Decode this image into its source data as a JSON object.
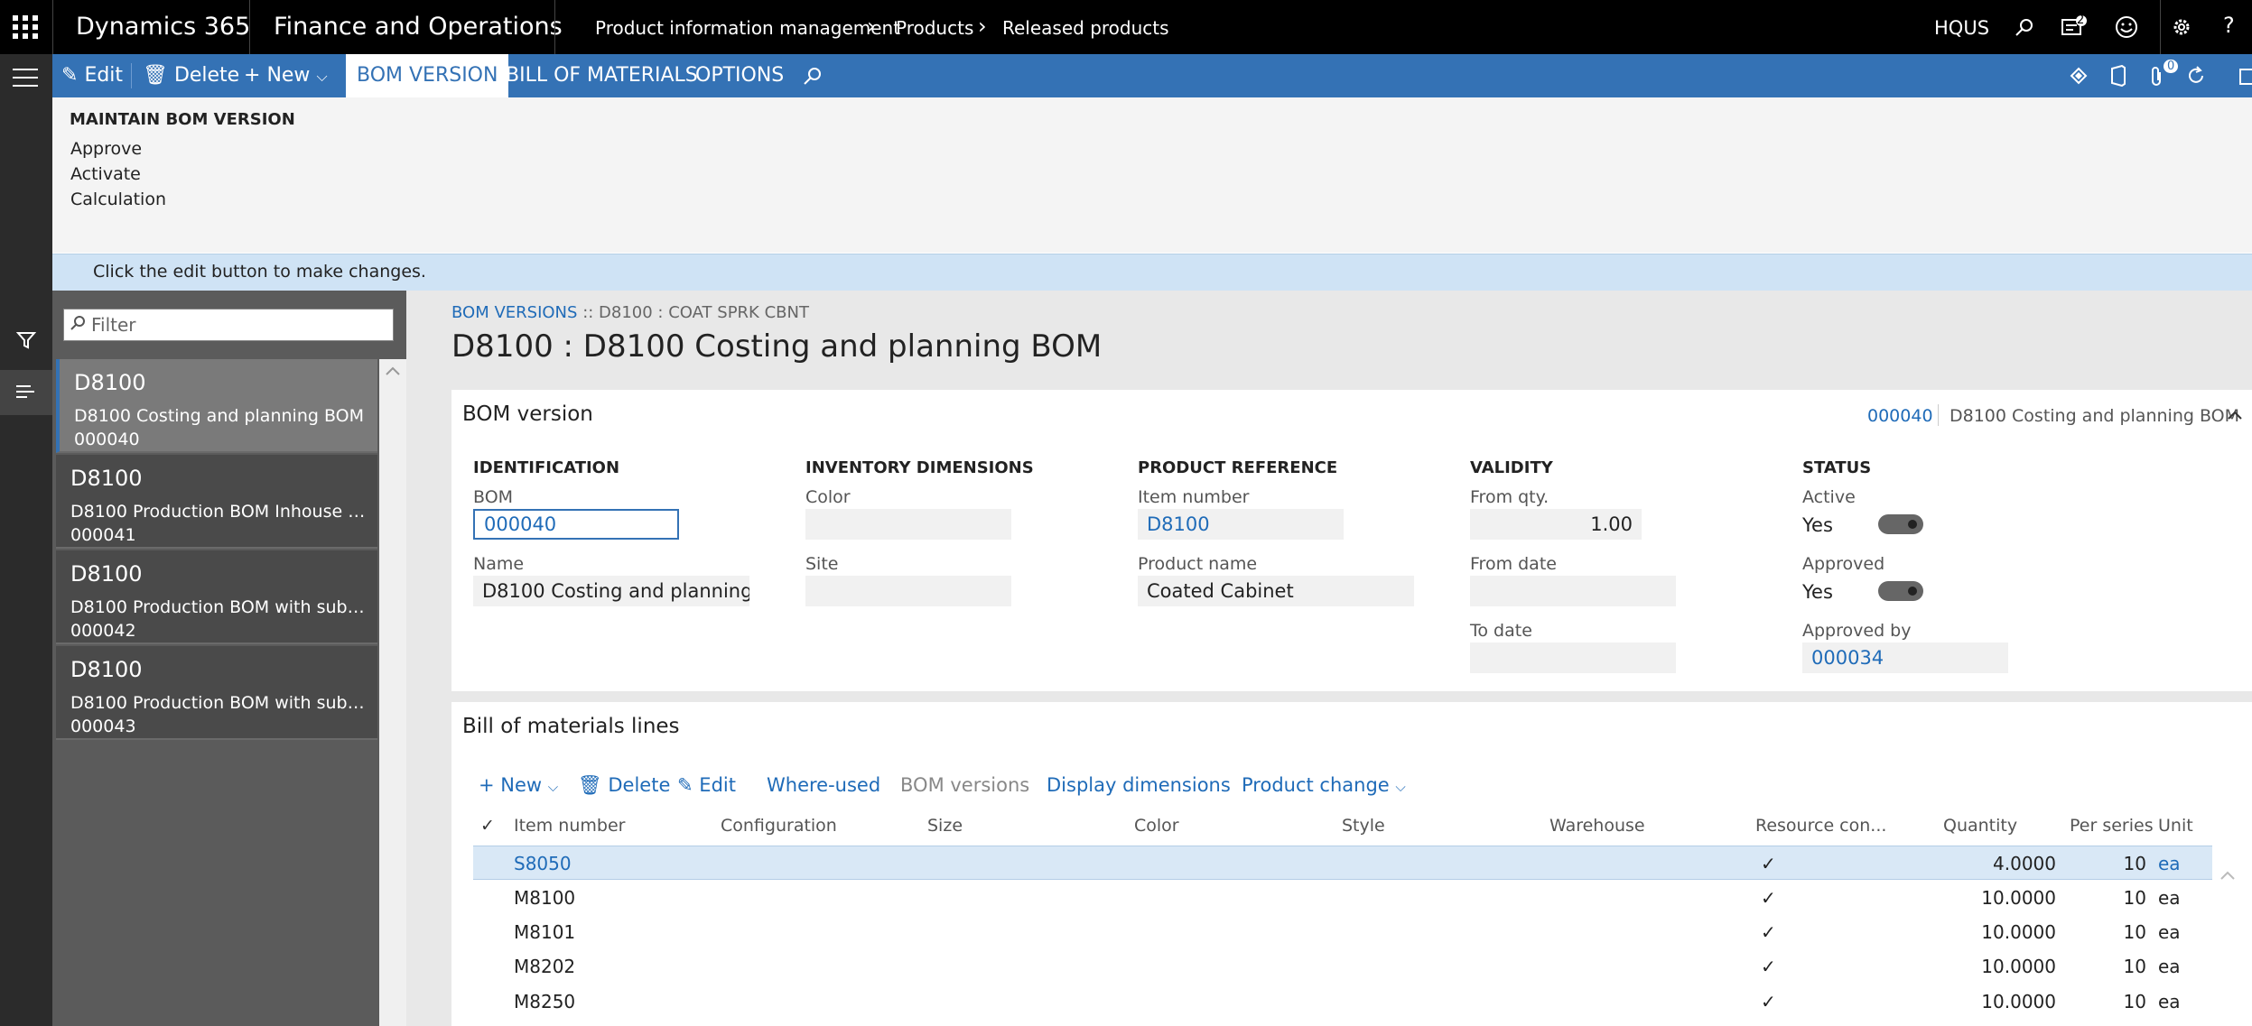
{
  "topbar": {
    "product": "Dynamics 365",
    "module": "Finance and Operations",
    "breadcrumb": [
      "Product information management",
      "Products",
      "Released products"
    ],
    "company": "HQUS",
    "notification_count": "2"
  },
  "actionbar": {
    "edit": "Edit",
    "delete": "Delete",
    "new": "New",
    "tabs": [
      "BOM VERSION",
      "BILL OF MATERIALS",
      "OPTIONS"
    ],
    "attach_count": "0"
  },
  "ribbon": {
    "group_title": "MAINTAIN BOM VERSION",
    "items": [
      "Approve",
      "Activate",
      "Calculation"
    ]
  },
  "infobar": {
    "message": "Click the edit button to make changes."
  },
  "list": {
    "filter_placeholder": "Filter",
    "items": [
      {
        "title": "D8100",
        "desc": "D8100 Costing and planning BOM",
        "id": "000040"
      },
      {
        "title": "D8100",
        "desc": "D8100 Production BOM Inhouse co...",
        "id": "000041"
      },
      {
        "title": "D8100",
        "desc": "D8100 Production BOM with subco...",
        "id": "000042"
      },
      {
        "title": "D8100",
        "desc": "D8100 Production BOM with subco...",
        "id": "000043"
      }
    ]
  },
  "main": {
    "breadcrumb_link": "BOM VERSIONS",
    "breadcrumb_rest": ":: D8100 : COAT SPRK CBNT",
    "title": "D8100 : D8100 Costing and planning BOM",
    "bom_version": {
      "header": "BOM version",
      "summary_id": "000040",
      "summary_name": "D8100 Costing and planning BOM",
      "identification": {
        "heading": "IDENTIFICATION",
        "bom_label": "BOM",
        "bom_value": "000040",
        "name_label": "Name",
        "name_value": "D8100 Costing and planning ..."
      },
      "inventory": {
        "heading": "INVENTORY DIMENSIONS",
        "color_label": "Color",
        "site_label": "Site"
      },
      "product": {
        "heading": "PRODUCT REFERENCE",
        "item_label": "Item number",
        "item_value": "D8100",
        "name_label": "Product name",
        "name_value": "Coated Cabinet"
      },
      "validity": {
        "heading": "VALIDITY",
        "from_qty_label": "From qty.",
        "from_qty_value": "1.00",
        "from_date_label": "From date",
        "to_date_label": "To date"
      },
      "status": {
        "heading": "STATUS",
        "active_label": "Active",
        "active_value": "Yes",
        "approved_label": "Approved",
        "approved_value": "Yes",
        "approved_by_label": "Approved by",
        "approved_by_value": "000034"
      }
    },
    "bom_lines": {
      "header": "Bill of materials lines",
      "toolbar": {
        "new": "New",
        "delete": "Delete",
        "edit": "Edit",
        "where_used": "Where-used",
        "bom_versions": "BOM versions",
        "display_dimensions": "Display dimensions",
        "product_change": "Product change"
      },
      "columns": [
        "Item number",
        "Configuration",
        "Size",
        "Color",
        "Style",
        "Warehouse",
        "Resource con...",
        "Quantity",
        "Per series",
        "Unit"
      ],
      "rows": [
        {
          "item": "S8050",
          "resource": true,
          "quantity": "4.0000",
          "per_series": "10",
          "unit": "ea"
        },
        {
          "item": "M8100",
          "resource": true,
          "quantity": "10.0000",
          "per_series": "10",
          "unit": "ea"
        },
        {
          "item": "M8101",
          "resource": true,
          "quantity": "10.0000",
          "per_series": "10",
          "unit": "ea"
        },
        {
          "item": "M8202",
          "resource": true,
          "quantity": "10.0000",
          "per_series": "10",
          "unit": "ea"
        },
        {
          "item": "M8250",
          "resource": true,
          "quantity": "10.0000",
          "per_series": "10",
          "unit": "ea"
        }
      ]
    }
  }
}
